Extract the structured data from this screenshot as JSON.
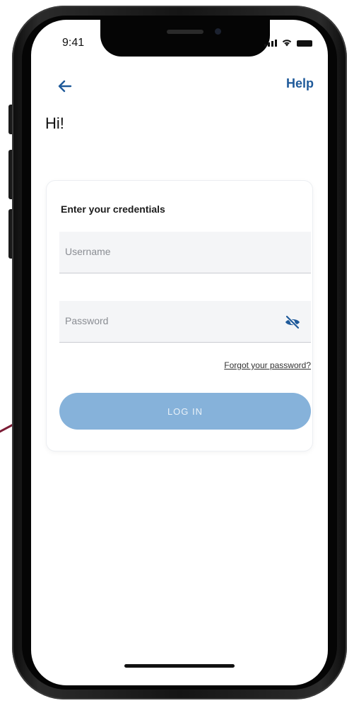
{
  "status_bar": {
    "time": "9:41"
  },
  "nav": {
    "help_label": "Help"
  },
  "greeting": "Hi!",
  "login_card": {
    "title": "Enter your credentials",
    "username_placeholder": "Username",
    "password_placeholder": "Password",
    "forgot_label": "Forgot your password?",
    "login_label": "LOG IN"
  },
  "colors": {
    "accent": "#1f5a9a",
    "button_disabled": "#86b2da",
    "connector": "#7b1c35"
  },
  "icons": {
    "back": "arrow-left-icon",
    "password_toggle": "eye-slash-icon"
  }
}
